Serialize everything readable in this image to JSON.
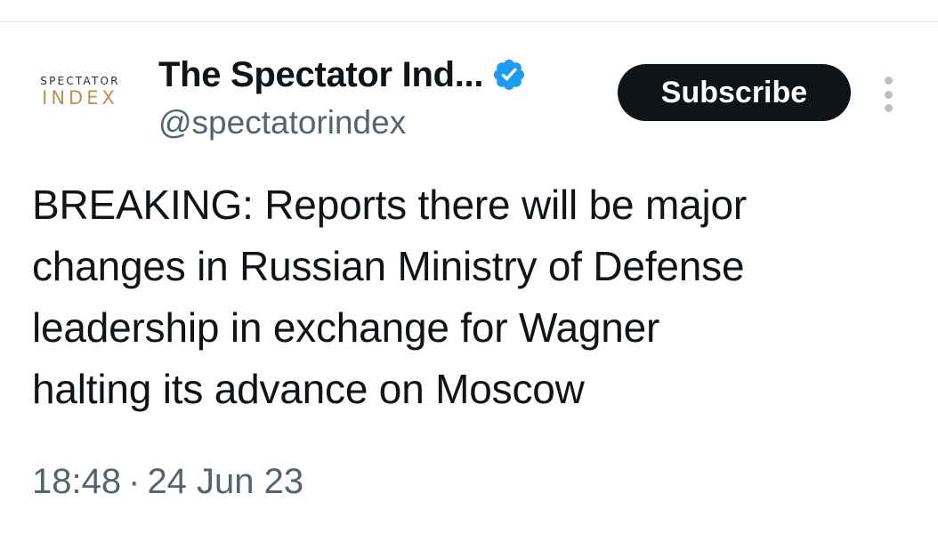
{
  "account": {
    "avatar_line1": "SPECTATOR",
    "avatar_line2": "INDEX",
    "display_name": "The Spectator Ind...",
    "handle": "@spectatorindex",
    "verified_icon": "verified-badge-icon",
    "verified_color": "#1d9bf0"
  },
  "actions": {
    "subscribe_label": "Subscribe",
    "more_icon": "more-vertical-icon"
  },
  "tweet": {
    "lines": [
      "BREAKING: Reports there will be major",
      "changes in Russian Ministry of Defense",
      "leadership in exchange for Wagner",
      "halting its advance on Moscow"
    ]
  },
  "meta": {
    "time": "18:48",
    "separator": "·",
    "date": "24 Jun 23"
  },
  "colors": {
    "text_primary": "#0f1419",
    "text_secondary": "#536471",
    "button_bg": "#0f1419",
    "button_text": "#ffffff",
    "logo_gold": "#b99152"
  }
}
